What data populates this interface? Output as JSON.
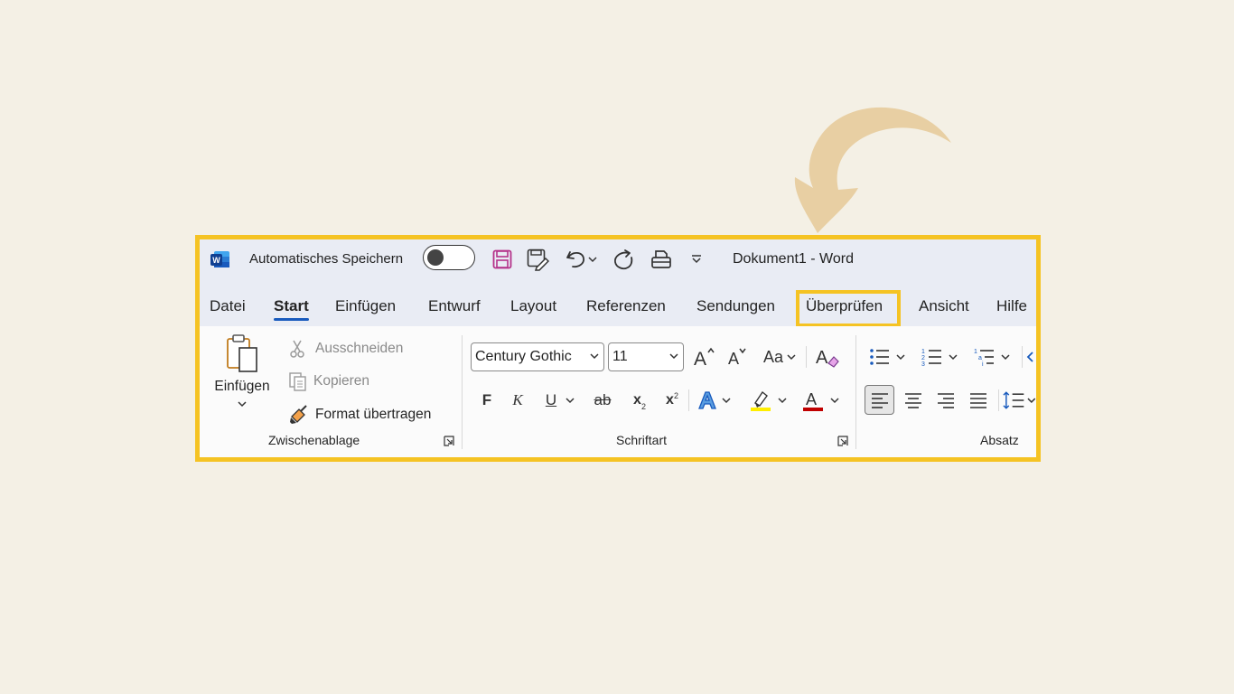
{
  "titlebar": {
    "autosave_label": "Automatisches Speichern",
    "document_title": "Dokument1  -  Word"
  },
  "tabs": [
    {
      "label": "Datei"
    },
    {
      "label": "Start"
    },
    {
      "label": "Einfügen"
    },
    {
      "label": "Entwurf"
    },
    {
      "label": "Layout"
    },
    {
      "label": "Referenzen"
    },
    {
      "label": "Sendungen"
    },
    {
      "label": "Überprüfen"
    },
    {
      "label": "Ansicht"
    },
    {
      "label": "Hilfe"
    }
  ],
  "clipboard": {
    "paste_label": "Einfügen",
    "cut_label": "Ausschneiden",
    "copy_label": "Kopieren",
    "format_painter_label": "Format übertragen",
    "group_label": "Zwischenablage"
  },
  "font": {
    "family": "Century Gothic",
    "size": "11",
    "bold": "F",
    "italic": "K",
    "underline": "U",
    "strikethrough": "ab",
    "subscript": "x",
    "subscript_mark": "2",
    "superscript": "x",
    "superscript_mark": "2",
    "change_case": "Aa",
    "group_label": "Schriftart"
  },
  "paragraph": {
    "group_label": "Absatz"
  },
  "colors": {
    "accent_frame": "#f5c323",
    "word_blue": "#185abd",
    "highlight_yellow": "#ffee00",
    "font_red": "#c00000",
    "arrow": "#e8cfa3"
  }
}
